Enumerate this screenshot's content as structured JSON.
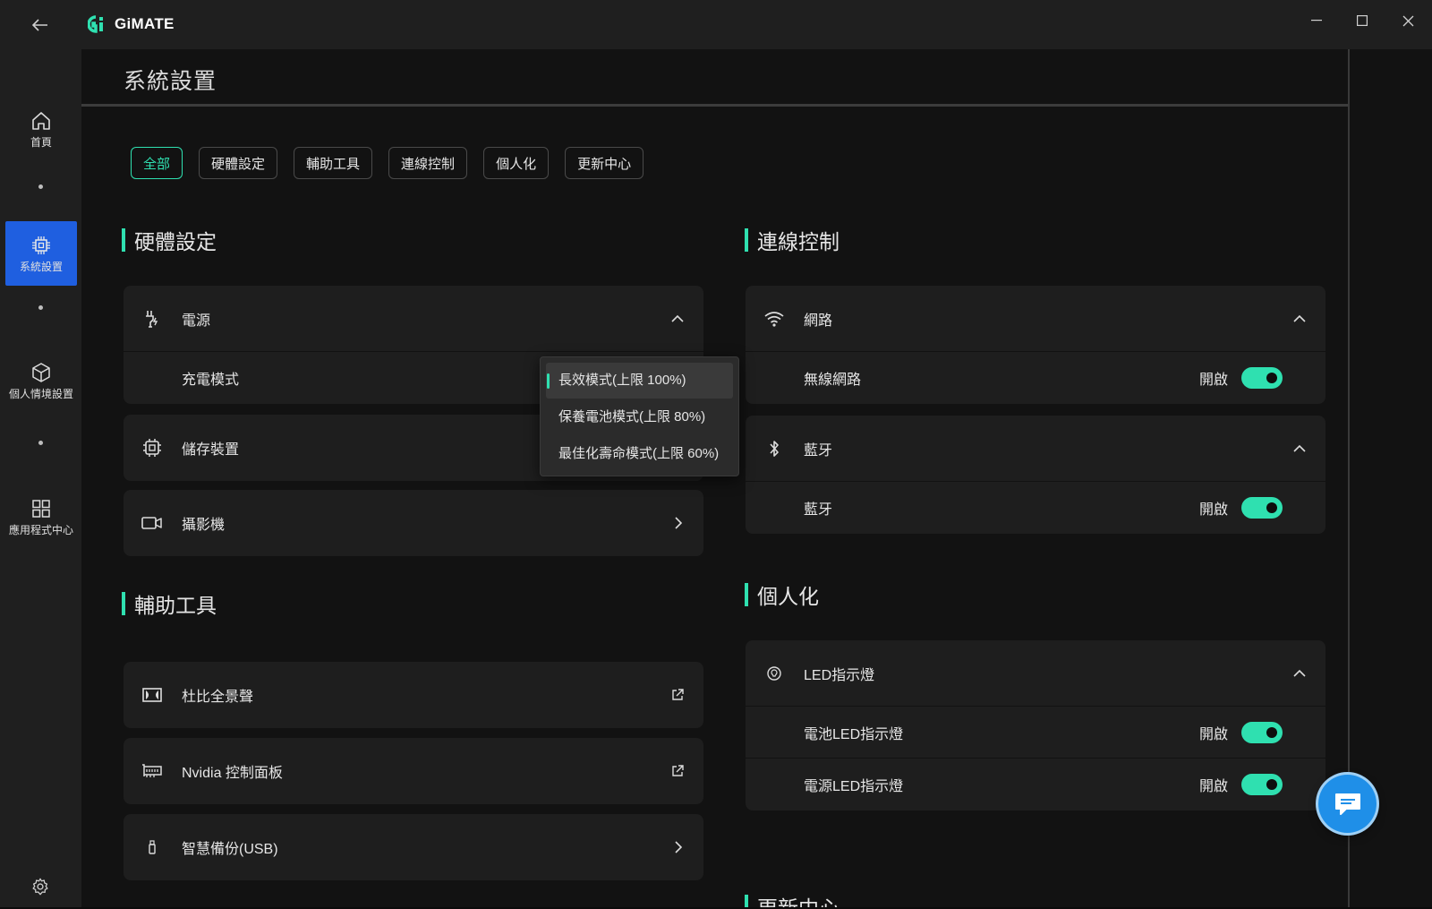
{
  "app": {
    "name": "GiMATE"
  },
  "sidebar": {
    "items": [
      {
        "label": "首頁",
        "icon": "home-icon"
      },
      {
        "label": "系統設置",
        "icon": "chip-icon",
        "active": true
      },
      {
        "label": "個人情境設置",
        "icon": "cube-icon"
      },
      {
        "label": "應用程式中心",
        "icon": "grid-icon"
      }
    ]
  },
  "page": {
    "title": "系統設置"
  },
  "tabs": [
    {
      "label": "全部",
      "active": true
    },
    {
      "label": "硬體設定"
    },
    {
      "label": "輔助工具"
    },
    {
      "label": "連線控制"
    },
    {
      "label": "個人化"
    },
    {
      "label": "更新中心"
    }
  ],
  "hardware": {
    "title": "硬體設定",
    "power": {
      "label": "電源",
      "charge_mode_label": "充電模式"
    },
    "storage": {
      "label": "儲存裝置"
    },
    "camera": {
      "label": "攝影機"
    }
  },
  "charge_dropdown": {
    "options": [
      "長效模式(上限 100%)",
      "保養電池模式(上限 80%)",
      "最佳化壽命模式(上限 60%)"
    ],
    "selected_index": 0
  },
  "tools": {
    "title": "輔助工具",
    "dolby": {
      "label": "杜比全景聲"
    },
    "nvidia": {
      "label": "Nvidia 控制面板"
    },
    "backup": {
      "label": "智慧備份(USB)"
    }
  },
  "connection": {
    "title": "連線控制",
    "network": {
      "label": "網路",
      "wifi_label": "無線網路",
      "wifi_state": "開啟"
    },
    "bluetooth": {
      "label": "藍牙",
      "bt_label": "藍牙",
      "bt_state": "開啟"
    }
  },
  "personal": {
    "title": "個人化",
    "led": {
      "label": "LED指示燈",
      "battery_led_label": "電池LED指示燈",
      "battery_led_state": "開啟",
      "power_led_label": "電源LED指示燈",
      "power_led_state": "開啟"
    }
  },
  "update": {
    "title": "更新中心"
  },
  "colors": {
    "accent": "#2fe0b0",
    "active_nav": "#1f5fe0",
    "fab": "#1f8fe8"
  }
}
